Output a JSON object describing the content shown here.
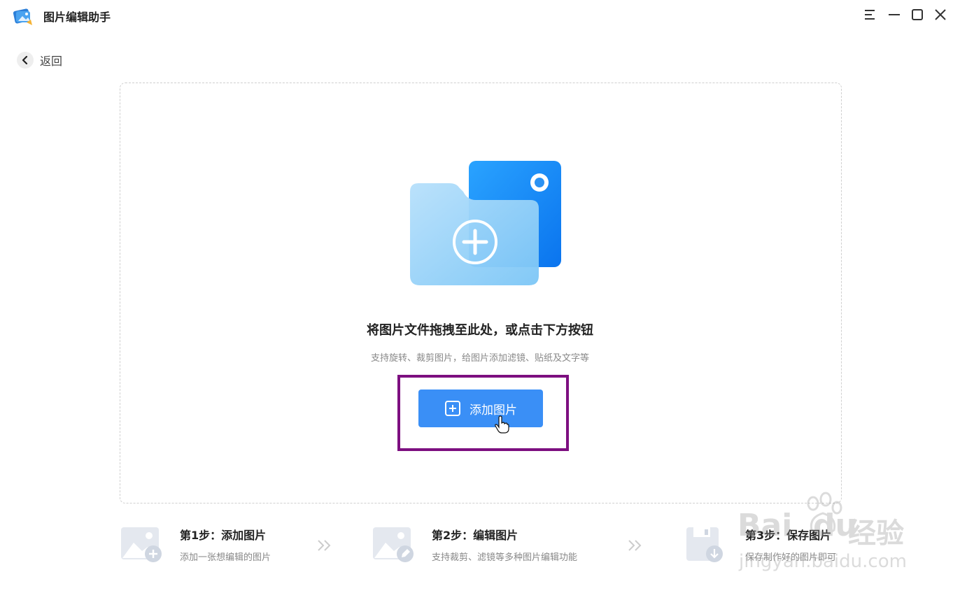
{
  "app": {
    "title": "图片编辑助手"
  },
  "window_controls": {
    "menu_icon": "menu-icon",
    "minimize_icon": "minimize-icon",
    "maximize_icon": "maximize-icon",
    "close_icon": "close-icon"
  },
  "back": {
    "label": "返回",
    "icon": "chevron-left-icon"
  },
  "dropzone": {
    "title": "将图片文件拖拽至此处，或点击下方按钮",
    "subtitle": "支持旋转、裁剪图片，给图片添加滤镜、贴纸及文字等",
    "add_button_label": "添加图片",
    "add_button_icon": "plus-square-icon",
    "illustration_icon": "folder-image-icon"
  },
  "steps": [
    {
      "title": "第1步：添加图片",
      "desc": "添加一张想编辑的图片",
      "icon": "image-add-icon"
    },
    {
      "title": "第2步：编辑图片",
      "desc": "支持裁剪、滤镜等多种图片编辑功能",
      "icon": "image-edit-icon"
    },
    {
      "title": "第3步：保存图片",
      "desc": "保存制作好的图片即可",
      "icon": "save-download-icon"
    }
  ],
  "watermark": {
    "brand": "Bai",
    "brand_suffix": "du",
    "cn": "经验",
    "url": "jingyan.baidu.com"
  },
  "colors": {
    "accent": "#3a8ff6",
    "highlight": "#7d0f80",
    "muted_text": "#888888"
  }
}
